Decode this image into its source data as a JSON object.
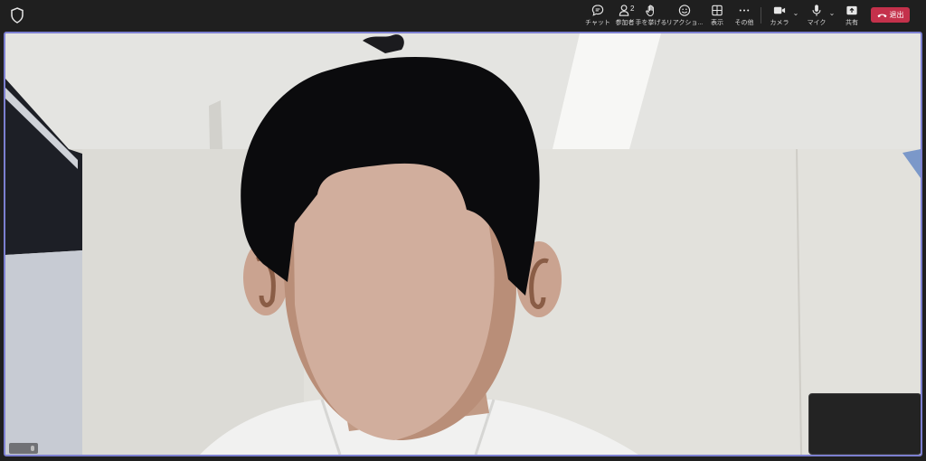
{
  "toolbar": {
    "chat_label": "チャット",
    "people_label": "参加者",
    "people_count": "2",
    "raise_label": "手を挙げる",
    "react_label": "リアクショ...",
    "view_label": "表示",
    "more_label": "その他",
    "camera_label": "カメラ",
    "mic_label": "マイク",
    "share_label": "共有",
    "leave_label": "退出",
    "leave_color": "#c4314b"
  },
  "icons": {
    "shield": "shield-icon",
    "chat": "chat-icon",
    "people": "people-icon",
    "raise": "hand-icon",
    "react": "smiley-icon",
    "view": "grid-icon",
    "more": "ellipsis-icon",
    "camera": "camera-icon",
    "mic": "mic-icon",
    "share": "share-icon",
    "leave": "phone-hangup-icon"
  },
  "colors": {
    "stage_border": "#7c7fd0",
    "toolbar_bg": "#1f1f1f"
  }
}
